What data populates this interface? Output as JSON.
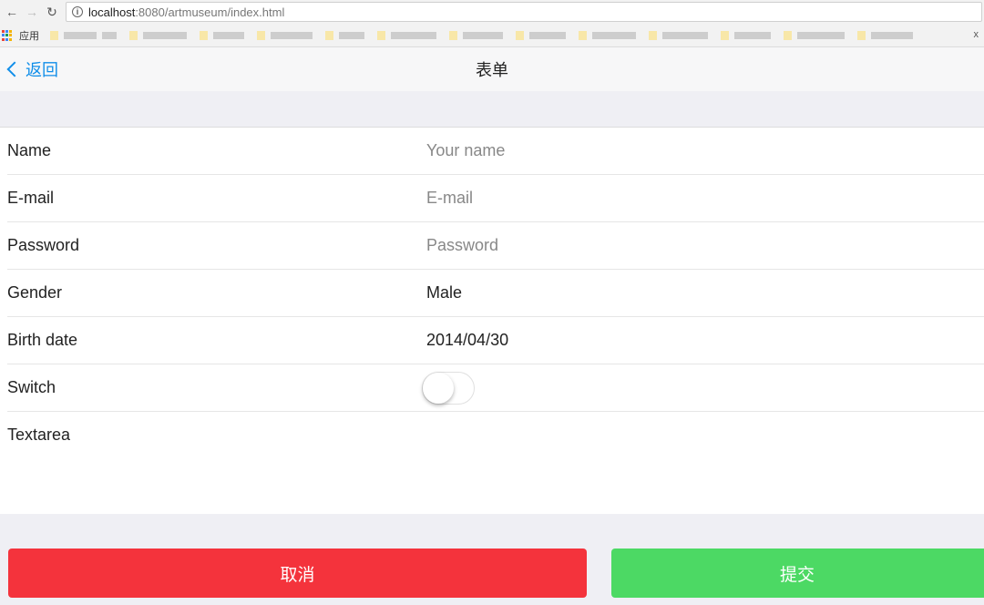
{
  "browser": {
    "url_host": "localhost",
    "url_rest": ":8080/artmuseum/index.html",
    "apps_label": "应用",
    "bookmarks_close": "x"
  },
  "header": {
    "back_label": "返回",
    "title": "表单"
  },
  "form": {
    "name": {
      "label": "Name",
      "placeholder": "Your name"
    },
    "email": {
      "label": "E-mail",
      "placeholder": "E-mail"
    },
    "password": {
      "label": "Password",
      "placeholder": "Password"
    },
    "gender": {
      "label": "Gender",
      "value": "Male"
    },
    "birth_date": {
      "label": "Birth date",
      "value": "2014/04/30"
    },
    "switch": {
      "label": "Switch",
      "on": false
    },
    "textarea": {
      "label": "Textarea"
    }
  },
  "actions": {
    "cancel_label": "取消",
    "submit_label": "提交"
  },
  "colors": {
    "accent": "#108ee9",
    "cancel": "#f4333c",
    "submit": "#4cd964",
    "background": "#efeff4"
  }
}
